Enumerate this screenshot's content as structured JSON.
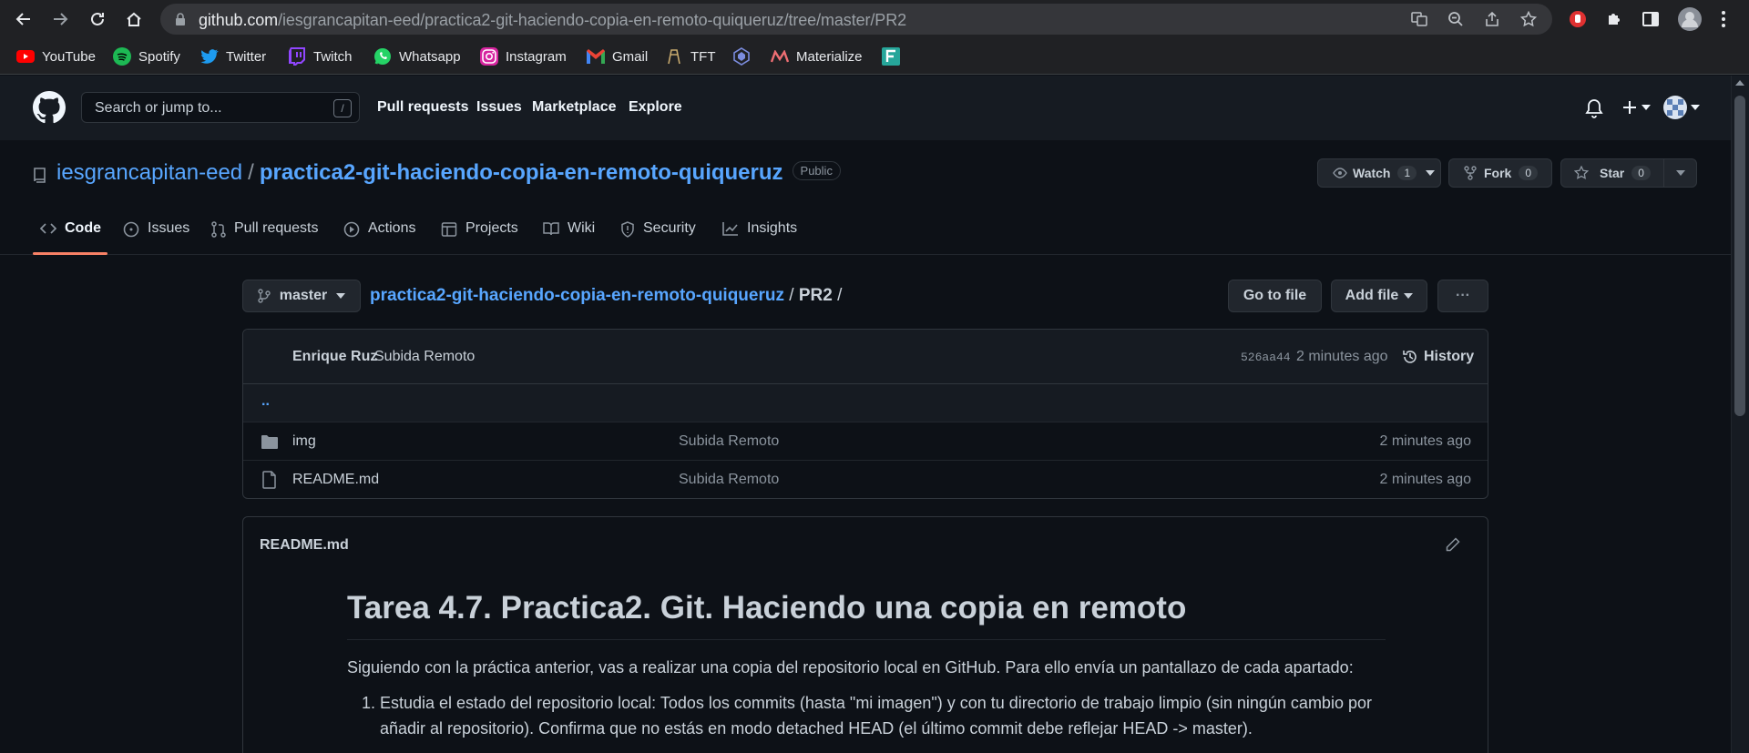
{
  "browser": {
    "url_host": "github.com",
    "url_path": "/iesgrancapitan-eed/practica2-git-haciendo-copia-en-remoto-quiqueruz/tree/master/PR2"
  },
  "bookmarks": [
    {
      "label": "YouTube",
      "icon": "youtube-icon",
      "color": "#ff0000"
    },
    {
      "label": "Spotify",
      "icon": "spotify-icon",
      "color": "#1db954"
    },
    {
      "label": "Twitter",
      "icon": "twitter-icon",
      "color": "#1d9bf0"
    },
    {
      "label": "Twitch",
      "icon": "twitch-icon",
      "color": "#9146ff"
    },
    {
      "label": "Whatsapp",
      "icon": "whatsapp-icon",
      "color": "#25d366"
    },
    {
      "label": "Instagram",
      "icon": "instagram-icon",
      "color": "#e1306c"
    },
    {
      "label": "Gmail",
      "icon": "gmail-icon",
      "color": "#ea4335"
    },
    {
      "label": "TFT",
      "icon": "tft-icon",
      "color": "#c8aa6e"
    },
    {
      "label": "",
      "icon": "league-icon",
      "color": "#7b8cde"
    },
    {
      "label": "Materialize",
      "icon": "materialize-icon",
      "color": "#ee6e73"
    },
    {
      "label": "",
      "icon": "f-app-icon",
      "color": "#26a69a"
    }
  ],
  "github_header": {
    "search_placeholder": "Search or jump to...",
    "search_shortcut": "/",
    "nav": [
      "Pull requests",
      "Issues",
      "Marketplace",
      "Explore"
    ]
  },
  "repo": {
    "owner": "iesgrancapitan-eed",
    "separator": "/",
    "name": "practica2-git-haciendo-copia-en-remoto-quiqueruz",
    "visibility": "Public",
    "watch_label": "Watch",
    "watch_count": "1",
    "fork_label": "Fork",
    "fork_count": "0",
    "star_label": "Star",
    "star_count": "0"
  },
  "tabs": [
    "Code",
    "Issues",
    "Pull requests",
    "Actions",
    "Projects",
    "Wiki",
    "Security",
    "Insights"
  ],
  "file_nav": {
    "branch": "master",
    "path_repo": "practica2-git-haciendo-copia-en-remoto-quiqueruz",
    "path_sep": "/",
    "path_dir": "PR2",
    "path_trail": "/",
    "go_to_file": "Go to file",
    "add_file": "Add file",
    "more": "···"
  },
  "commit": {
    "author": "Enrique Ruz",
    "message": "Subida Remoto",
    "sha": "526aa44",
    "time": "2 minutes ago",
    "history_label": "History"
  },
  "files": {
    "up": "..",
    "rows": [
      {
        "name": "img",
        "type": "folder",
        "message": "Subida Remoto",
        "time": "2 minutes ago"
      },
      {
        "name": "README.md",
        "type": "file",
        "message": "Subida Remoto",
        "time": "2 minutes ago"
      }
    ]
  },
  "readme": {
    "filename": "README.md",
    "h1": "Tarea 4.7. Practica2. Git. Haciendo una copia en remoto",
    "intro": "Siguiendo con la práctica anterior, vas a realizar una copia del repositorio local en GitHub. Para ello envía un pantallazo de cada apartado:",
    "item1_num": "1.",
    "item1": "Estudia el estado del repositorio local: Todos los commits (hasta \"mi imagen\") y con tu directorio de trabajo limpio (sin ningún cambio por añadir al repositorio). Confirma que no estás en modo detached HEAD (el último commit debe reflejar HEAD -> master)."
  }
}
